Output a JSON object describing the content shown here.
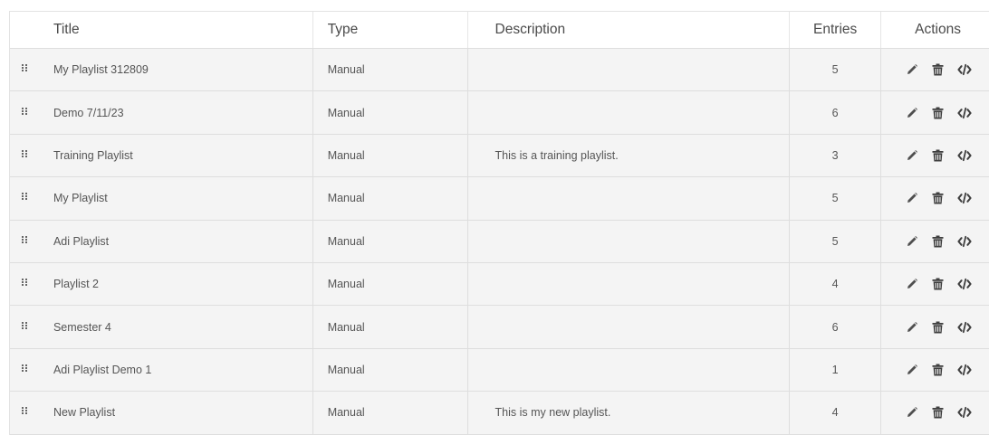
{
  "table": {
    "columns": {
      "title": "Title",
      "type": "Type",
      "description": "Description",
      "entries": "Entries",
      "actions": "Actions"
    },
    "icons": {
      "drag": "drag-handle-icon",
      "edit": "pencil-icon",
      "delete": "trash-icon",
      "embed": "code-icon"
    },
    "rows": [
      {
        "title": "My Playlist 312809",
        "type": "Manual",
        "description": "",
        "entries": "5"
      },
      {
        "title": "Demo 7/11/23",
        "type": "Manual",
        "description": "",
        "entries": "6"
      },
      {
        "title": "Training Playlist",
        "type": "Manual",
        "description": "This is a training playlist.",
        "entries": "3"
      },
      {
        "title": "My Playlist",
        "type": "Manual",
        "description": "",
        "entries": "5"
      },
      {
        "title": "Adi Playlist",
        "type": "Manual",
        "description": "",
        "entries": "5"
      },
      {
        "title": "Playlist 2",
        "type": "Manual",
        "description": "",
        "entries": "4"
      },
      {
        "title": "Semester 4",
        "type": "Manual",
        "description": "",
        "entries": "6"
      },
      {
        "title": "Adi Playlist Demo 1",
        "type": "Manual",
        "description": "",
        "entries": "1"
      },
      {
        "title": "New Playlist",
        "type": "Manual",
        "description": "This is my new playlist.",
        "entries": "4"
      }
    ]
  }
}
